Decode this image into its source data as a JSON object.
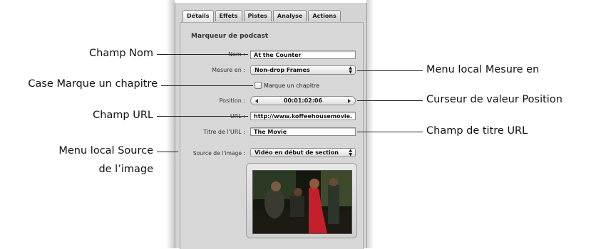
{
  "tabs": [
    "Détails",
    "Effets",
    "Pistes",
    "Analyse",
    "Actions"
  ],
  "section_title": "Marqueur de podcast",
  "fields": {
    "nom_label": "Nom :",
    "nom_value": "At the Counter",
    "mesure_label": "Mesure en :",
    "mesure_value": "Non-drop Frames",
    "checkbox_label": "Marque un chapitre",
    "position_label": "Position :",
    "position_value": "00:01:02:06",
    "url_label": "URL :",
    "url_value": "http://www.koffeehousemovie.",
    "titre_url_label": "Titre de l'URL :",
    "titre_url_value": "The Movie",
    "source_label": "Source de l'image :",
    "source_value": "Vidéo en début de section"
  },
  "callouts": {
    "champ_nom": "Champ Nom",
    "case_chapitre": "Case Marque un chapitre",
    "champ_url": "Champ URL",
    "menu_source_1": "Menu local Source",
    "menu_source_2": "de l’image",
    "menu_mesure": "Menu local Mesure en",
    "curseur_position": "Curseur de valeur Position",
    "champ_titre_url": "Champ de titre URL"
  },
  "icons": [
    "popup-arrows-icon",
    "left-arrow-icon",
    "right-arrow-icon"
  ]
}
